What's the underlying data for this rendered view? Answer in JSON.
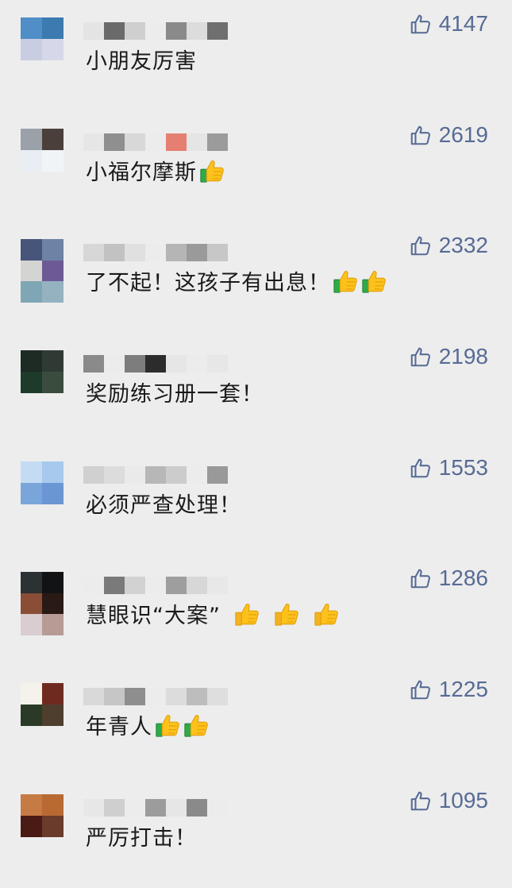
{
  "comments": [
    {
      "text": "小朋友厉害",
      "likes": "4147",
      "emoji_count": 0,
      "emoji_style": "yellow",
      "avatar": [
        "#4f8ec7",
        "#3c7ab0",
        "#c9cde1",
        "#d6d8ea"
      ],
      "nick": [
        "#e4e4e4",
        "#6a6a6a",
        "#cfcfcf",
        "#ececec",
        "#8a8a8a",
        "#dcdcdc",
        "#6f6f6f"
      ]
    },
    {
      "text": "小福尔摩斯",
      "likes": "2619",
      "emoji_count": 1,
      "emoji_style": "green",
      "avatar": [
        "#9aa1a8",
        "#4a3f3a",
        "#e8eef3",
        "#f0f4f7"
      ],
      "nick": [
        "#e6e6e6",
        "#8f8f8f",
        "#d8d8d8",
        "#ececec",
        "#e57f72",
        "#e5e5e5",
        "#9b9b9b"
      ]
    },
    {
      "text": "了不起！这孩子有出息！",
      "likes": "2332",
      "emoji_count": 2,
      "emoji_style": "green",
      "avatar": [
        "#48557a",
        "#6e82a6",
        "#d4d5d3",
        "#6c5a96",
        "#7fa6b5",
        "#95b2c0"
      ],
      "tall": true,
      "nick": [
        "#d7d7d7",
        "#c2c2c2",
        "#e0e0e0",
        "#ececec",
        "#b5b5b5",
        "#9a9a9a",
        "#c7c7c7"
      ]
    },
    {
      "text": "奖励练习册一套！",
      "likes": "2198",
      "emoji_count": 0,
      "emoji_style": "yellow",
      "avatar": [
        "#1e2a24",
        "#2f3a34",
        "#1d3a2a",
        "#3a4c3e"
      ],
      "nick": [
        "#8a8a8a",
        "#ececec",
        "#7d7d7d",
        "#2c2c2c",
        "#e6e6e6",
        "#ececec",
        "#e7e7e7"
      ]
    },
    {
      "text": "必须严查处理！",
      "likes": "1553",
      "emoji_count": 0,
      "emoji_style": "yellow",
      "avatar": [
        "#c3dcf3",
        "#a6c9ec",
        "#7aa5da",
        "#6a96d3"
      ],
      "nick": [
        "#d0d0d0",
        "#dcdcdc",
        "#eaeaea",
        "#b7b7b7",
        "#cccccc",
        "#ececec",
        "#999999"
      ]
    },
    {
      "text": "慧眼识“大案”",
      "likes": "1286",
      "emoji_count": 3,
      "emoji_style": "yellow",
      "avatar": [
        "#2c3134",
        "#121314",
        "#8a4e36",
        "#2a1a15",
        "#d9cdd1",
        "#b69c94"
      ],
      "tall": true,
      "nick": [
        "#ececec",
        "#7a7a7a",
        "#d2d2d2",
        "#ececec",
        "#9e9e9e",
        "#d7d7d7",
        "#e8e8e8"
      ]
    },
    {
      "text": "年青人",
      "likes": "1225",
      "emoji_count": 2,
      "emoji_style": "green",
      "avatar": [
        "#f4f2ea",
        "#6f2a20",
        "#2a3a26",
        "#4e3e2e"
      ],
      "nick": [
        "#d9d9d9",
        "#c6c6c6",
        "#8e8e8e",
        "#ececec",
        "#dcdcdc",
        "#bdbdbd",
        "#dedede"
      ]
    },
    {
      "text": "严厉打击！",
      "likes": "1095",
      "emoji_count": 0,
      "emoji_style": "yellow",
      "avatar": [
        "#c77b44",
        "#b86a32",
        "#4a1a14",
        "#6a3a2a"
      ],
      "nick": [
        "#e7e7e7",
        "#cfcfcf",
        "#ececec",
        "#9c9c9c",
        "#e6e6e6",
        "#8a8a8a",
        "#ececec"
      ]
    }
  ],
  "icons": {
    "like": "thumbs-up-outline-icon",
    "emoji": "thumbs-up-emoji-icon"
  },
  "colors": {
    "like_text": "#576b95",
    "background": "#ededed",
    "comment_text": "#1a1a1a"
  }
}
